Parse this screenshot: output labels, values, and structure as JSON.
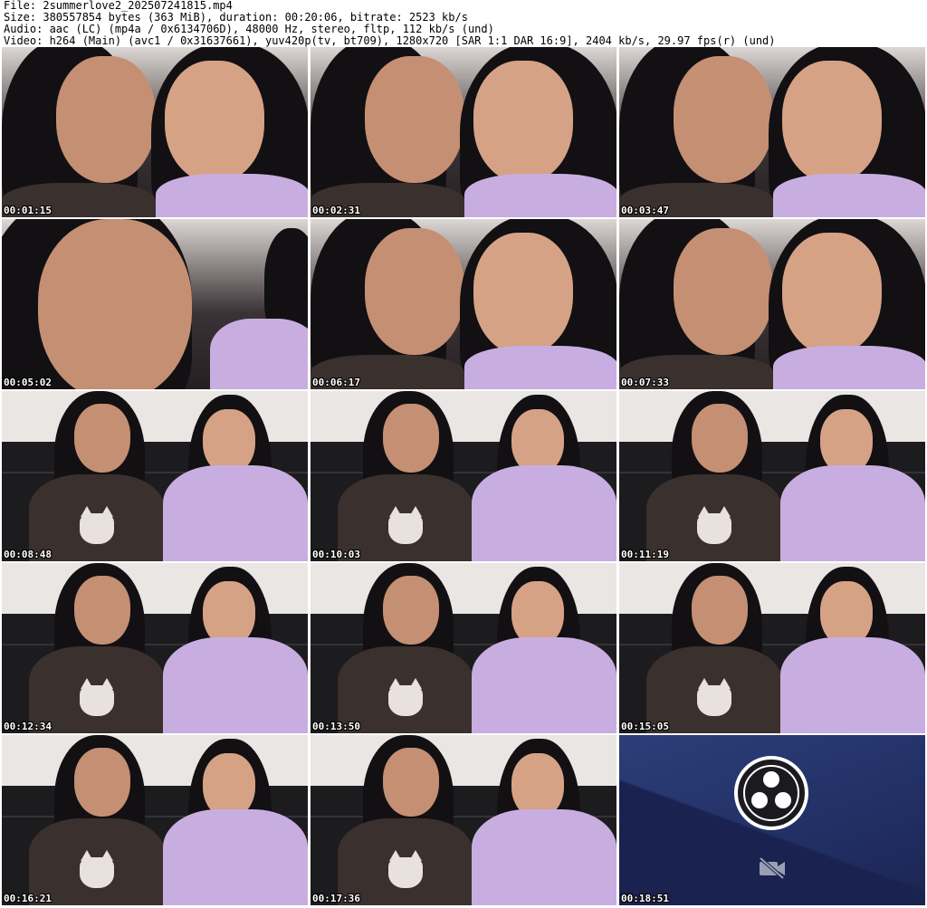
{
  "header": {
    "file_line": "File: 2summerlove2_202507241815.mp4",
    "size_line": "Size: 380557854 bytes (363 MiB), duration: 00:20:06, bitrate: 2523 kb/s",
    "audio_line": "Audio: aac (LC) (mp4a / 0x6134706D), 48000 Hz, stereo, fltp, 112 kb/s (und)",
    "video_line": "Video: h264 (Main) (avc1 / 0x31637661), yuv420p(tv, bt709), 1280x720 [SAR 1:1 DAR 16:9], 2404 kb/s, 29.97 fps(r) (und)"
  },
  "thumbnails": [
    {
      "timestamp": "00:01:15",
      "scene": "closeup-two"
    },
    {
      "timestamp": "00:02:31",
      "scene": "closeup-two"
    },
    {
      "timestamp": "00:03:47",
      "scene": "closeup-two"
    },
    {
      "timestamp": "00:05:02",
      "scene": "closeup-one"
    },
    {
      "timestamp": "00:06:17",
      "scene": "closeup-two"
    },
    {
      "timestamp": "00:07:33",
      "scene": "closeup-two"
    },
    {
      "timestamp": "00:08:48",
      "scene": "sofa-two"
    },
    {
      "timestamp": "00:10:03",
      "scene": "sofa-two"
    },
    {
      "timestamp": "00:11:19",
      "scene": "sofa-two"
    },
    {
      "timestamp": "00:12:34",
      "scene": "sofa-two"
    },
    {
      "timestamp": "00:13:50",
      "scene": "sofa-two"
    },
    {
      "timestamp": "00:15:05",
      "scene": "sofa-two"
    },
    {
      "timestamp": "00:16:21",
      "scene": "sofa-two"
    },
    {
      "timestamp": "00:17:36",
      "scene": "sofa-two"
    },
    {
      "timestamp": "00:18:51",
      "scene": "obs-end"
    }
  ],
  "icons": {
    "end_frame_logo": "obs-logo-icon",
    "end_frame_camera": "camera-off-icon"
  },
  "colors": {
    "obs_background": "#24336a",
    "lilac_shirt": "#c8aee0"
  }
}
